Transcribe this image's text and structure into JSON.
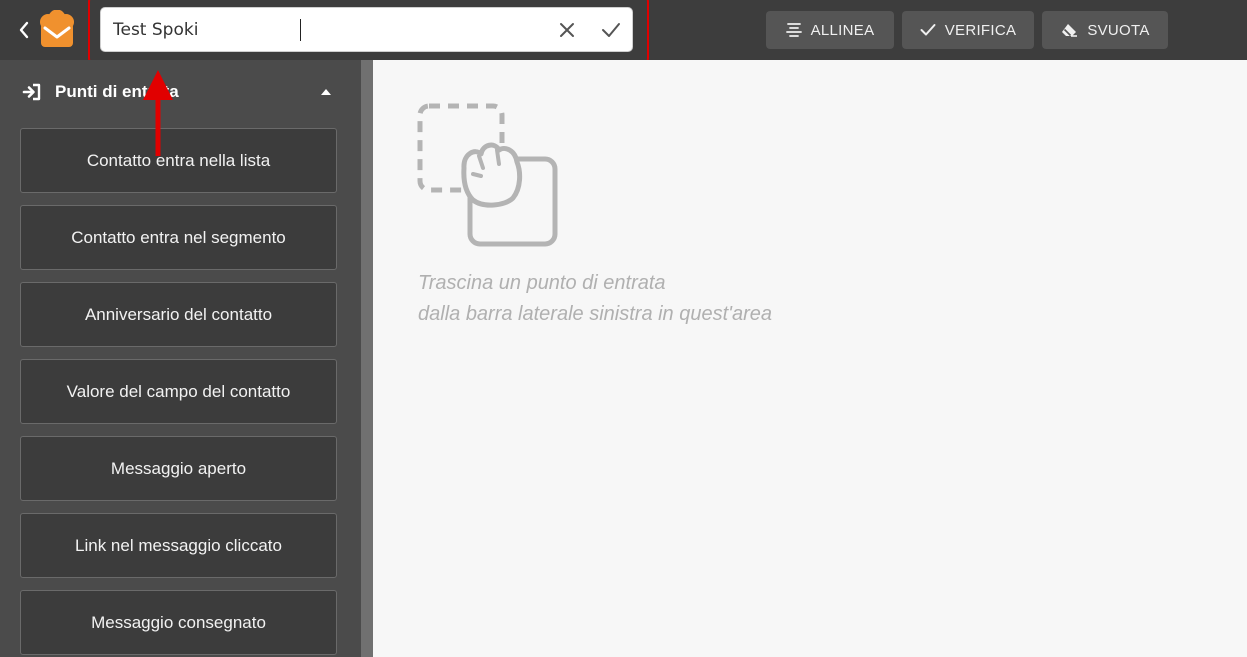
{
  "header": {
    "title_value": "Test Spoki",
    "buttons": {
      "align_label": "ALLINEA",
      "verify_label": "VERIFICA",
      "clear_label": "SVUOTA"
    }
  },
  "sidebar": {
    "section_title": "Punti di entrata",
    "items": [
      {
        "label": "Contatto entra nella lista"
      },
      {
        "label": "Contatto entra nel segmento"
      },
      {
        "label": "Anniversario del contatto"
      },
      {
        "label": "Valore del campo del contatto"
      },
      {
        "label": "Messaggio aperto"
      },
      {
        "label": "Link nel messaggio cliccato"
      },
      {
        "label": "Messaggio consegnato"
      }
    ]
  },
  "canvas": {
    "hint_line1": "Trascina un punto di entrata",
    "hint_line2": "dalla barra laterale sinistra in quest'area"
  },
  "icons": {
    "back": "chevron-left-icon",
    "logo": "spoki-logo-icon",
    "clear": "close-icon",
    "confirm": "check-icon",
    "align": "align-center-icon",
    "verify": "check-icon",
    "erase": "eraser-icon",
    "entry": "login-arrow-icon",
    "collapse": "caret-up-icon",
    "drag": "drag-hand-icon"
  },
  "colors": {
    "topbar": "#3d3d3d",
    "sidebar": "#4b4b4b",
    "item_bg": "#3c3c3c",
    "button_bg": "#555555",
    "canvas": "#f7f7f7",
    "logo_orange": "#f0912e",
    "highlight": "#e10000"
  }
}
